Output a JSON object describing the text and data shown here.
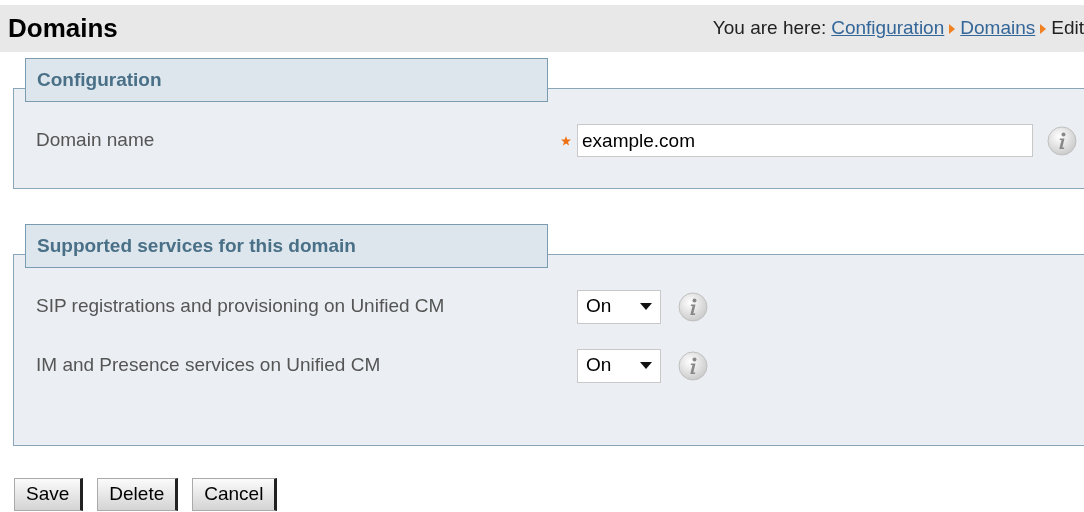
{
  "page_title": "Domains",
  "breadcrumb": {
    "prefix": "You are here:",
    "links": [
      "Configuration",
      "Domains"
    ],
    "current": "Edit"
  },
  "sections": [
    {
      "title": "Configuration",
      "fields": [
        {
          "kind": "text",
          "label": "Domain name",
          "required": true,
          "value": "example.com"
        }
      ]
    },
    {
      "title": "Supported services for this domain",
      "fields": [
        {
          "kind": "select",
          "label": "SIP registrations and provisioning on Unified CM",
          "required": false,
          "value": "On"
        },
        {
          "kind": "select",
          "label": "IM and Presence services on Unified CM",
          "required": false,
          "value": "On"
        }
      ]
    }
  ],
  "buttons": [
    "Save",
    "Delete",
    "Cancel"
  ]
}
